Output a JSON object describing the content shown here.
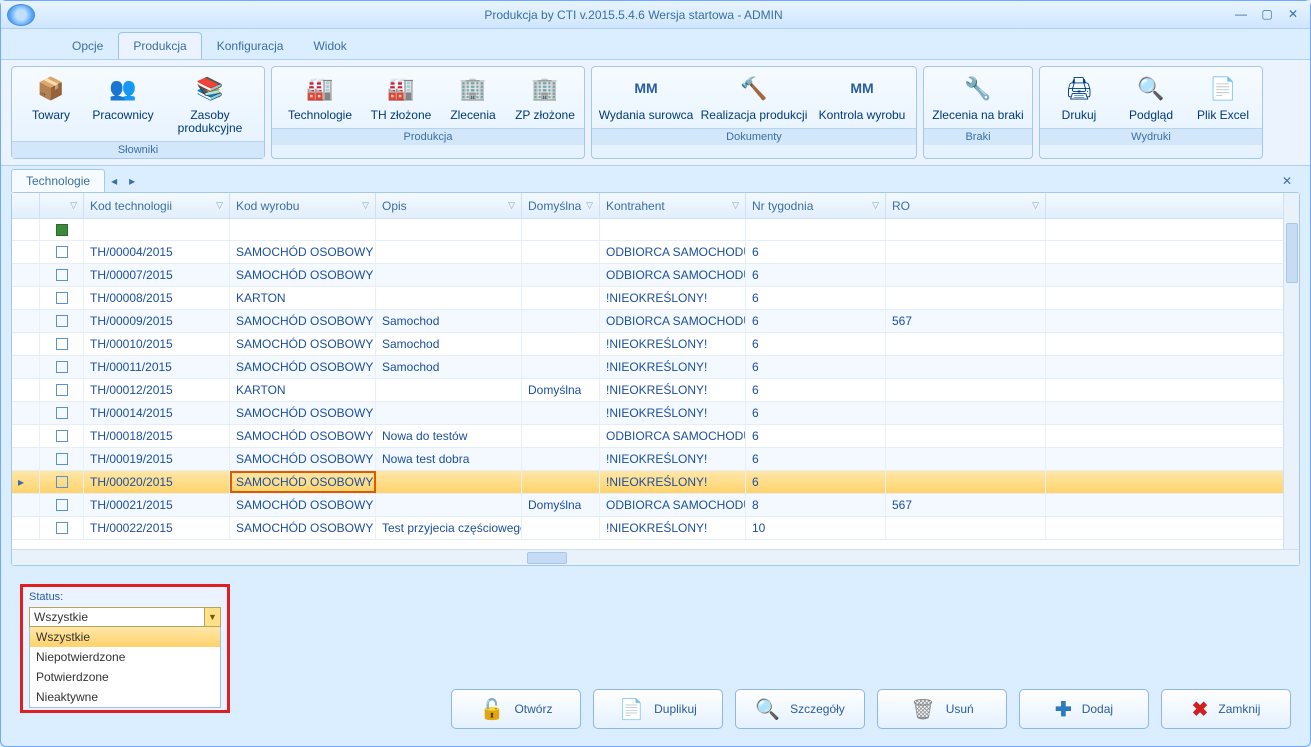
{
  "window": {
    "title": "Produkcja by CTI v.2015.5.4.6 Wersja startowa - ADMIN"
  },
  "menu": {
    "tabs": [
      "Opcje",
      "Produkcja",
      "Konfiguracja",
      "Widok"
    ],
    "active": "Produkcja"
  },
  "ribbon": {
    "groups": [
      {
        "caption": "Słowniki",
        "items": [
          {
            "label": "Towary",
            "icon": "📦"
          },
          {
            "label": "Pracownicy",
            "icon": "👥"
          },
          {
            "label": "Zasoby produkcyjne",
            "icon": "📚"
          }
        ]
      },
      {
        "caption": "Produkcja",
        "items": [
          {
            "label": "Technologie",
            "icon": "🏭"
          },
          {
            "label": "TH złożone",
            "icon": "🏭"
          },
          {
            "label": "Zlecenia",
            "icon": "🏢"
          },
          {
            "label": "ZP złożone",
            "icon": "🏢"
          }
        ]
      },
      {
        "caption": "Dokumenty",
        "items": [
          {
            "label": "Wydania surowca",
            "icon": "MM"
          },
          {
            "label": "Realizacja produkcji",
            "icon": "🔨"
          },
          {
            "label": "Kontrola wyrobu",
            "icon": "MM"
          }
        ]
      },
      {
        "caption": "Braki",
        "items": [
          {
            "label": "Zlecenia na braki",
            "icon": "🔧"
          }
        ]
      },
      {
        "caption": "Wydruki",
        "items": [
          {
            "label": "Drukuj",
            "icon": "🖨"
          },
          {
            "label": "Podgląd",
            "icon": "🔍"
          },
          {
            "label": "Plik Excel",
            "icon": "📄"
          }
        ]
      }
    ]
  },
  "workspace": {
    "tab": "Technologie"
  },
  "grid": {
    "columns": [
      "",
      "",
      "Kod technologii",
      "Kod wyrobu",
      "Opis",
      "Domyślna",
      "Kontrahent",
      "Nr tygodnia",
      "RO"
    ],
    "rows": [
      {
        "kod": "TH/00004/2015",
        "wyrob": "SAMOCHÓD OSOBOWY B",
        "opis": "",
        "dom": "",
        "kontr": "ODBIORCA  SAMOCHODU...",
        "nr": "6",
        "ro": ""
      },
      {
        "kod": "TH/00007/2015",
        "wyrob": "SAMOCHÓD OSOBOWY B",
        "opis": "",
        "dom": "",
        "kontr": "ODBIORCA  SAMOCHODU...",
        "nr": "6",
        "ro": ""
      },
      {
        "kod": "TH/00008/2015",
        "wyrob": "KARTON",
        "opis": "",
        "dom": "",
        "kontr": "!NIEOKREŚLONY!",
        "nr": "6",
        "ro": ""
      },
      {
        "kod": "TH/00009/2015",
        "wyrob": "SAMOCHÓD OSOBOWY B",
        "opis": "Samochod",
        "dom": "",
        "kontr": "ODBIORCA  SAMOCHODU...",
        "nr": "6",
        "ro": "567"
      },
      {
        "kod": "TH/00010/2015",
        "wyrob": "SAMOCHÓD OSOBOWY B",
        "opis": "Samochod",
        "dom": "",
        "kontr": "!NIEOKREŚLONY!",
        "nr": "6",
        "ro": ""
      },
      {
        "kod": "TH/00011/2015",
        "wyrob": "SAMOCHÓD OSOBOWY B",
        "opis": "Samochod",
        "dom": "",
        "kontr": "!NIEOKREŚLONY!",
        "nr": "6",
        "ro": ""
      },
      {
        "kod": "TH/00012/2015",
        "wyrob": "KARTON",
        "opis": "",
        "dom": "Domyślna",
        "kontr": "!NIEOKREŚLONY!",
        "nr": "6",
        "ro": ""
      },
      {
        "kod": "TH/00014/2015",
        "wyrob": "SAMOCHÓD OSOBOWY C",
        "opis": "",
        "dom": "",
        "kontr": "!NIEOKREŚLONY!",
        "nr": "6",
        "ro": ""
      },
      {
        "kod": "TH/00018/2015",
        "wyrob": "SAMOCHÓD OSOBOWY C",
        "opis": "Nowa do testów",
        "dom": "",
        "kontr": "ODBIORCA  SAMOCHODU...",
        "nr": "6",
        "ro": ""
      },
      {
        "kod": "TH/00019/2015",
        "wyrob": "SAMOCHÓD OSOBOWY C",
        "opis": "Nowa test dobra",
        "dom": "",
        "kontr": "!NIEOKREŚLONY!",
        "nr": "6",
        "ro": ""
      },
      {
        "kod": "TH/00020/2015",
        "wyrob": "SAMOCHÓD OSOBOWY B",
        "opis": "",
        "dom": "",
        "kontr": "!NIEOKREŚLONY!",
        "nr": "6",
        "ro": "",
        "selected": true
      },
      {
        "kod": "TH/00021/2015",
        "wyrob": "SAMOCHÓD OSOBOWY B",
        "opis": "",
        "dom": "Domyślna",
        "kontr": "ODBIORCA  SAMOCHODU...",
        "nr": "8",
        "ro": "567"
      },
      {
        "kod": "TH/00022/2015",
        "wyrob": "SAMOCHÓD OSOBOWY B",
        "opis": "Test przyjecia częściowego",
        "dom": "",
        "kontr": "!NIEOKREŚLONY!",
        "nr": "10",
        "ro": ""
      }
    ]
  },
  "status": {
    "label": "Status:",
    "value": "Wszystkie",
    "options": [
      "Wszystkie",
      "Niepotwierdzone",
      "Potwierdzone",
      "Nieaktywne"
    ]
  },
  "buttons": {
    "open": "Otwórz",
    "dup": "Duplikuj",
    "det": "Szczegóły",
    "del": "Usuń",
    "add": "Dodaj",
    "close": "Zamknij"
  }
}
